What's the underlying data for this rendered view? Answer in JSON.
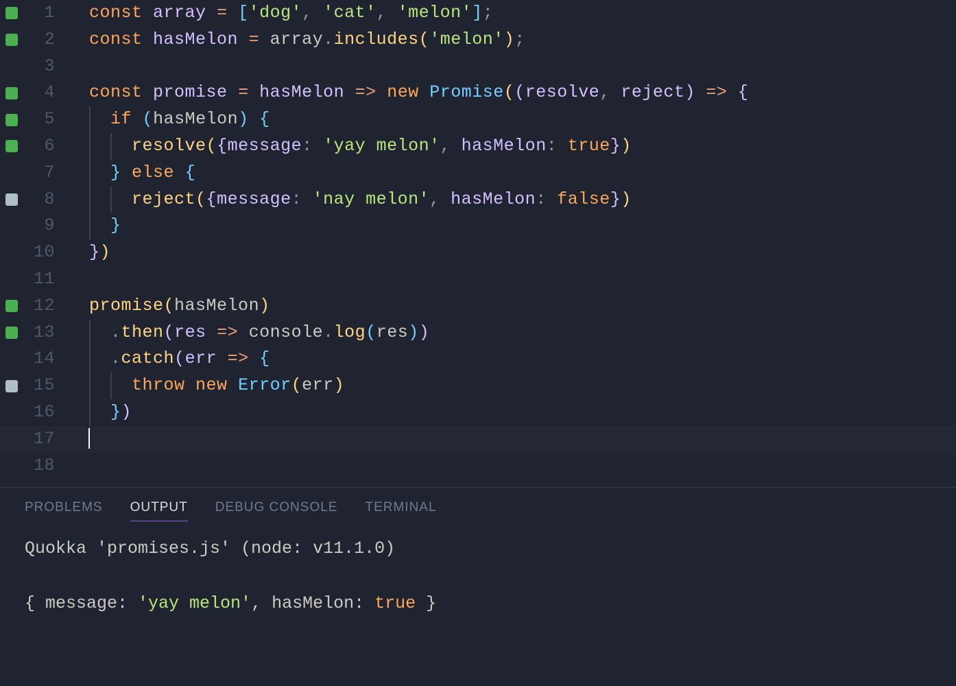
{
  "editor": {
    "current_line": 17,
    "lines": [
      {
        "num": 1,
        "marker": "green"
      },
      {
        "num": 2,
        "marker": "green"
      },
      {
        "num": 3,
        "marker": null
      },
      {
        "num": 4,
        "marker": "green"
      },
      {
        "num": 5,
        "marker": "green"
      },
      {
        "num": 6,
        "marker": "green"
      },
      {
        "num": 7,
        "marker": null
      },
      {
        "num": 8,
        "marker": "gray"
      },
      {
        "num": 9,
        "marker": null
      },
      {
        "num": 10,
        "marker": null
      },
      {
        "num": 11,
        "marker": null
      },
      {
        "num": 12,
        "marker": "green"
      },
      {
        "num": 13,
        "marker": "green"
      },
      {
        "num": 14,
        "marker": null
      },
      {
        "num": 15,
        "marker": "gray"
      },
      {
        "num": 16,
        "marker": null
      },
      {
        "num": 17,
        "marker": null
      },
      {
        "num": 18,
        "marker": null
      }
    ],
    "code_tokens": {
      "l1": [
        [
          "kw",
          "const"
        ],
        [
          "ident",
          " "
        ],
        [
          "def",
          "array"
        ],
        [
          "ident",
          " "
        ],
        [
          "op",
          "="
        ],
        [
          "ident",
          " "
        ],
        [
          "brack-b",
          "["
        ],
        [
          "str",
          "'dog'"
        ],
        [
          "punct",
          ", "
        ],
        [
          "str",
          "'cat'"
        ],
        [
          "punct",
          ", "
        ],
        [
          "str",
          "'melon'"
        ],
        [
          "brack-b",
          "]"
        ],
        [
          "punct",
          ";"
        ]
      ],
      "l2": [
        [
          "kw",
          "const"
        ],
        [
          "ident",
          " "
        ],
        [
          "def",
          "hasMelon"
        ],
        [
          "ident",
          " "
        ],
        [
          "op",
          "="
        ],
        [
          "ident",
          " "
        ],
        [
          "ident",
          "array"
        ],
        [
          "punct",
          "."
        ],
        [
          "func",
          "includes"
        ],
        [
          "paren-y",
          "("
        ],
        [
          "str",
          "'melon'"
        ],
        [
          "paren-y",
          ")"
        ],
        [
          "punct",
          ";"
        ]
      ],
      "l3": [],
      "l4": [
        [
          "kw",
          "const"
        ],
        [
          "ident",
          " "
        ],
        [
          "def",
          "promise"
        ],
        [
          "ident",
          " "
        ],
        [
          "op",
          "="
        ],
        [
          "ident",
          " "
        ],
        [
          "param",
          "hasMelon"
        ],
        [
          "ident",
          " "
        ],
        [
          "op",
          "=>"
        ],
        [
          "ident",
          " "
        ],
        [
          "kw",
          "new"
        ],
        [
          "ident",
          " "
        ],
        [
          "type",
          "Promise"
        ],
        [
          "paren-y",
          "("
        ],
        [
          "paren-p",
          "("
        ],
        [
          "param",
          "resolve"
        ],
        [
          "punct",
          ", "
        ],
        [
          "param",
          "reject"
        ],
        [
          "paren-p",
          ")"
        ],
        [
          "ident",
          " "
        ],
        [
          "op",
          "=>"
        ],
        [
          "ident",
          " "
        ],
        [
          "paren-p",
          "{"
        ]
      ],
      "l5": [
        [
          "ident",
          "  "
        ],
        [
          "kw",
          "if"
        ],
        [
          "ident",
          " "
        ],
        [
          "paren-b",
          "("
        ],
        [
          "ident",
          "hasMelon"
        ],
        [
          "paren-b",
          ")"
        ],
        [
          "ident",
          " "
        ],
        [
          "paren-b",
          "{"
        ]
      ],
      "l6": [
        [
          "ident",
          "    "
        ],
        [
          "func",
          "resolve"
        ],
        [
          "paren-y",
          "("
        ],
        [
          "paren-p",
          "{"
        ],
        [
          "def",
          "message"
        ],
        [
          "punct",
          ": "
        ],
        [
          "str",
          "'yay melon'"
        ],
        [
          "punct",
          ", "
        ],
        [
          "def",
          "hasMelon"
        ],
        [
          "punct",
          ": "
        ],
        [
          "bool",
          "true"
        ],
        [
          "paren-p",
          "}"
        ],
        [
          "paren-y",
          ")"
        ]
      ],
      "l7": [
        [
          "ident",
          "  "
        ],
        [
          "paren-b",
          "}"
        ],
        [
          "ident",
          " "
        ],
        [
          "kw",
          "else"
        ],
        [
          "ident",
          " "
        ],
        [
          "paren-b",
          "{"
        ]
      ],
      "l8": [
        [
          "ident",
          "    "
        ],
        [
          "func",
          "reject"
        ],
        [
          "paren-y",
          "("
        ],
        [
          "paren-p",
          "{"
        ],
        [
          "def",
          "message"
        ],
        [
          "punct",
          ": "
        ],
        [
          "str",
          "'nay melon'"
        ],
        [
          "punct",
          ", "
        ],
        [
          "def",
          "hasMelon"
        ],
        [
          "punct",
          ": "
        ],
        [
          "bool",
          "false"
        ],
        [
          "paren-p",
          "}"
        ],
        [
          "paren-y",
          ")"
        ]
      ],
      "l9": [
        [
          "ident",
          "  "
        ],
        [
          "paren-b",
          "}"
        ]
      ],
      "l10": [
        [
          "paren-p",
          "}"
        ],
        [
          "paren-y",
          ")"
        ]
      ],
      "l11": [],
      "l12": [
        [
          "func",
          "promise"
        ],
        [
          "paren-y",
          "("
        ],
        [
          "ident",
          "hasMelon"
        ],
        [
          "paren-y",
          ")"
        ]
      ],
      "l13": [
        [
          "ident",
          "  "
        ],
        [
          "punct",
          "."
        ],
        [
          "func",
          "then"
        ],
        [
          "paren-p",
          "("
        ],
        [
          "param",
          "res"
        ],
        [
          "ident",
          " "
        ],
        [
          "op",
          "=>"
        ],
        [
          "ident",
          " "
        ],
        [
          "ident",
          "console"
        ],
        [
          "punct",
          "."
        ],
        [
          "func",
          "log"
        ],
        [
          "paren-b",
          "("
        ],
        [
          "ident",
          "res"
        ],
        [
          "paren-b",
          ")"
        ],
        [
          "paren-p",
          ")"
        ]
      ],
      "l14": [
        [
          "ident",
          "  "
        ],
        [
          "punct",
          "."
        ],
        [
          "func",
          "catch"
        ],
        [
          "paren-p",
          "("
        ],
        [
          "param",
          "err"
        ],
        [
          "ident",
          " "
        ],
        [
          "op",
          "=>"
        ],
        [
          "ident",
          " "
        ],
        [
          "paren-b",
          "{"
        ]
      ],
      "l15": [
        [
          "ident",
          "    "
        ],
        [
          "kw",
          "throw"
        ],
        [
          "ident",
          " "
        ],
        [
          "kw",
          "new"
        ],
        [
          "ident",
          " "
        ],
        [
          "type",
          "Error"
        ],
        [
          "paren-y",
          "("
        ],
        [
          "ident",
          "err"
        ],
        [
          "paren-y",
          ")"
        ]
      ],
      "l16": [
        [
          "ident",
          "  "
        ],
        [
          "paren-b",
          "}"
        ],
        [
          "paren-p",
          ")"
        ]
      ],
      "l17": [],
      "l18": []
    },
    "indent_guides": {
      "l5": [
        0
      ],
      "l6": [
        0,
        1
      ],
      "l7": [
        0
      ],
      "l8": [
        0,
        1
      ],
      "l9": [
        0
      ],
      "l13": [
        0
      ],
      "l14": [
        0
      ],
      "l15": [
        0,
        1
      ],
      "l16": [
        0
      ]
    }
  },
  "panel": {
    "tabs": {
      "problems": "PROBLEMS",
      "output": "OUTPUT",
      "debug_console": "DEBUG CONSOLE",
      "terminal": "TERMINAL"
    },
    "active_tab": "output",
    "output_lines": [
      [
        [
          "ident",
          "Quokka 'promises.js' (node: v11.1.0)"
        ]
      ],
      [],
      [
        [
          "ident",
          "{ message: "
        ],
        [
          "out-str",
          "'yay melon'"
        ],
        [
          "ident",
          ", hasMelon: "
        ],
        [
          "out-bool",
          "true"
        ],
        [
          "ident",
          " }"
        ]
      ]
    ]
  }
}
